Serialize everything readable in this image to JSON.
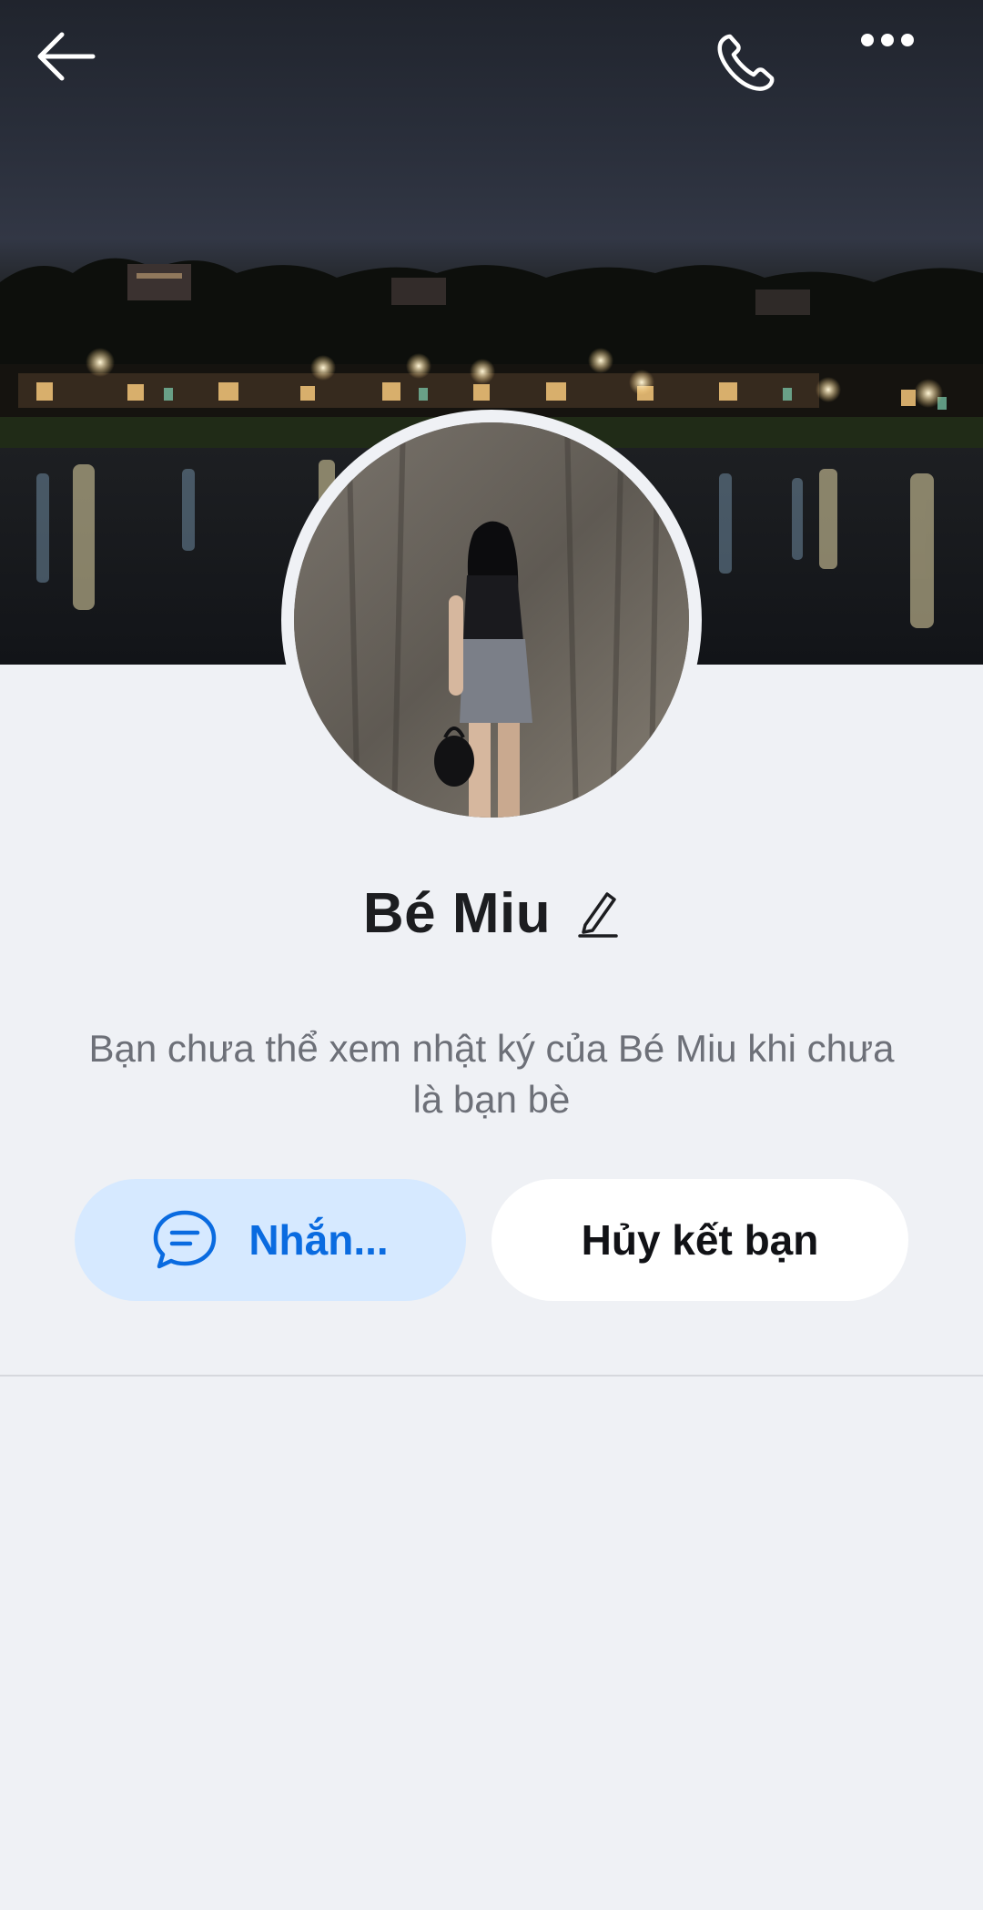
{
  "profile": {
    "name": "Bé Miu",
    "diary_notice": "Bạn chưa thể xem nhật ký của Bé Miu khi chưa là bạn bè"
  },
  "header": {
    "back_icon": "arrow-left-icon",
    "call_icon": "phone-icon",
    "more_icon": "more-horizontal-icon"
  },
  "actions": {
    "message_label": "Nhắn...",
    "message_icon": "chat-bubble-icon",
    "unfriend_label": "Hủy kết bạn"
  },
  "colors": {
    "accent": "#0a6be0",
    "message_button_bg": "#d6e9ff",
    "page_bg": "#eff1f5"
  }
}
